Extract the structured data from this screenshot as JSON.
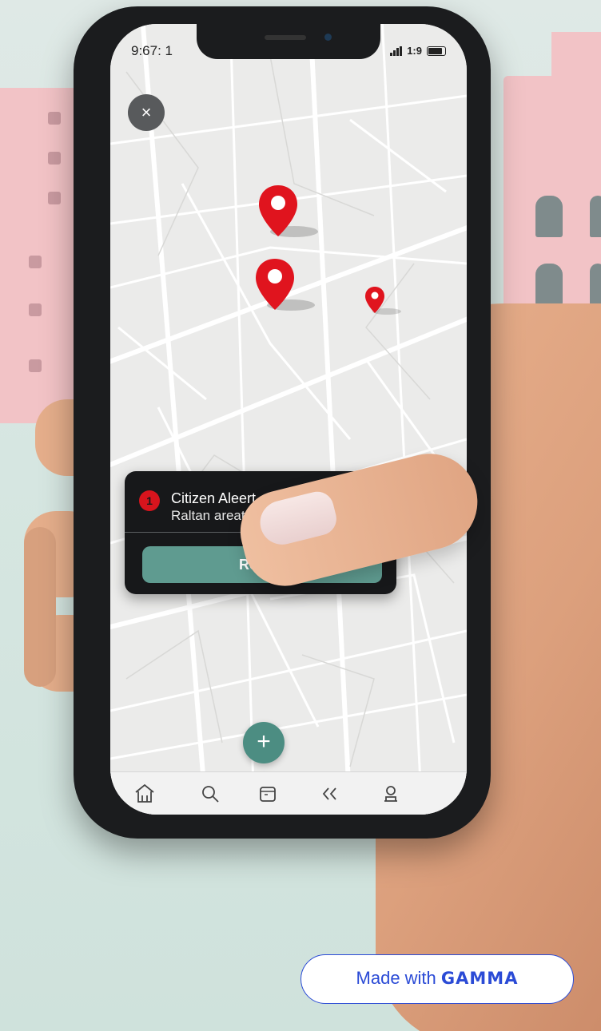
{
  "status_bar": {
    "time": "9:67: 1",
    "network": "1:9"
  },
  "map": {
    "close_label": "×",
    "pins": [
      "alert-pin",
      "alert-pin",
      "alert-pin"
    ]
  },
  "alert": {
    "badge": "1",
    "title": "Citizen Aleert",
    "subtitle": "Raltan areatty",
    "report_label": "Report"
  },
  "fab": {
    "label": "+"
  },
  "tabbar": {
    "items": [
      "home-icon",
      "search-icon",
      "calendar-icon",
      "back-icon",
      "profile-icon"
    ]
  },
  "badge": {
    "made_with": "Made with",
    "brand": "GAMMA",
    "brand_color": "#2b4bd6"
  },
  "colors": {
    "pin": "#e0141e",
    "accent": "#5f9b90",
    "card": "#17181a"
  }
}
